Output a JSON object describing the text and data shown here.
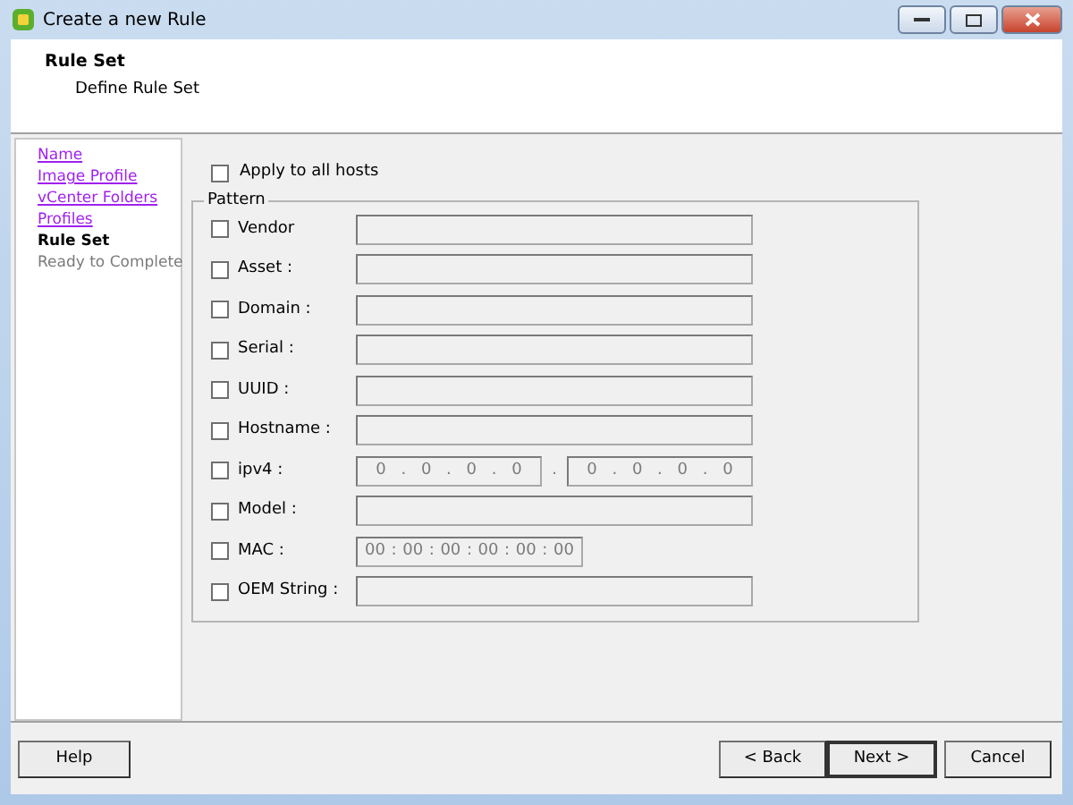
{
  "window": {
    "title": "Create a new Rule"
  },
  "header": {
    "title": "Rule Set",
    "subtitle": "Define Rule Set"
  },
  "steps": [
    {
      "label": "Name",
      "kind": "link"
    },
    {
      "label": "Image Profile",
      "kind": "link"
    },
    {
      "label": "vCenter Folders",
      "kind": "link"
    },
    {
      "label": "Profiles",
      "kind": "link"
    },
    {
      "label": "Rule Set",
      "kind": "current"
    },
    {
      "label": "Ready to Complete",
      "kind": "pending"
    }
  ],
  "apply_all": {
    "label": "Apply to all hosts",
    "checked": false
  },
  "pattern": {
    "legend": "Pattern",
    "rows": [
      {
        "label": "Vendor",
        "checked": false,
        "kind": "text"
      },
      {
        "label": "Asset :",
        "checked": false,
        "kind": "text"
      },
      {
        "label": "Domain :",
        "checked": false,
        "kind": "text"
      },
      {
        "label": "Serial :",
        "checked": false,
        "kind": "text"
      },
      {
        "label": "UUID :",
        "checked": false,
        "kind": "text"
      },
      {
        "label": "Hostname :",
        "checked": false,
        "kind": "text"
      },
      {
        "label": "ipv4 :",
        "checked": false,
        "kind": "iprange",
        "joiner": ".",
        "ranges": [
          {
            "parts": [
              "0",
              "0",
              "0",
              "0"
            ],
            "separator": "."
          },
          {
            "parts": [
              "0",
              "0",
              "0",
              "0"
            ],
            "separator": "."
          }
        ]
      },
      {
        "label": "Model :",
        "checked": false,
        "kind": "text"
      },
      {
        "label": "MAC :",
        "checked": false,
        "kind": "mac",
        "parts": [
          "00",
          "00",
          "00",
          "00",
          "00",
          "00"
        ],
        "separator": ":"
      },
      {
        "label": "OEM String :",
        "checked": false,
        "kind": "text"
      }
    ]
  },
  "buttons": {
    "help": "Help",
    "back": "< Back",
    "next": "Next >",
    "cancel": "Cancel"
  }
}
